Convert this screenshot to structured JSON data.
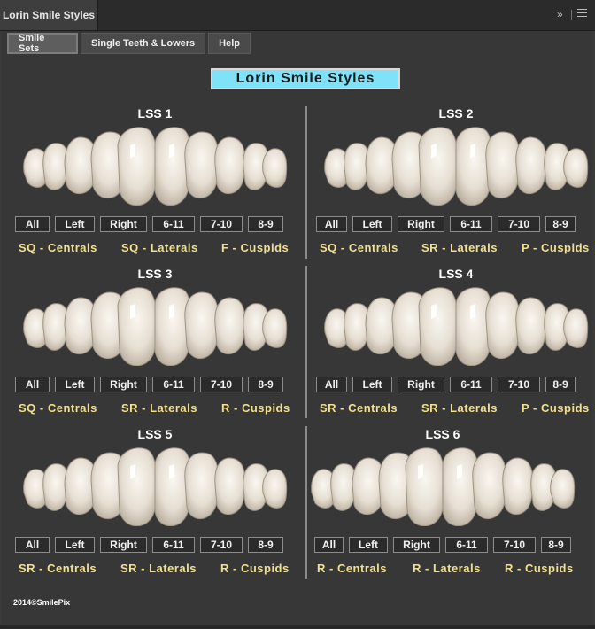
{
  "window": {
    "tab_title": "Lorin Smile Styles"
  },
  "subtabs": [
    "Smile Sets",
    "Single Teeth & Lowers",
    "Help"
  ],
  "banner": "Lorin Smile Styles",
  "buttons": [
    "All",
    "Left",
    "Right",
    "6-11",
    "7-10",
    "8-9"
  ],
  "sets": [
    {
      "title": "LSS 1",
      "labels": [
        "SQ - Centrals",
        "SQ - Laterals",
        "F - Cuspids"
      ]
    },
    {
      "title": "LSS 2",
      "labels": [
        "SQ - Centrals",
        "SR - Laterals",
        "P - Cuspids"
      ]
    },
    {
      "title": "LSS 3",
      "labels": [
        "SQ - Centrals",
        "SR - Laterals",
        "R - Cuspids"
      ]
    },
    {
      "title": "LSS 4",
      "labels": [
        "SR - Centrals",
        "SR - Laterals",
        "P - Cuspids"
      ]
    },
    {
      "title": "LSS 5",
      "labels": [
        "SR - Centrals",
        "SR - Laterals",
        "R - Cuspids"
      ]
    },
    {
      "title": "LSS 6",
      "labels": [
        "R - Centrals",
        "R - Laterals",
        "R - Cuspids"
      ]
    }
  ],
  "footer": {
    "copyright": "2014©SmilePix"
  },
  "colors": {
    "banner_bg": "#7fe2f8",
    "label_text": "#f1e08c",
    "panel_bg": "#373737"
  },
  "icons": [
    "collapse-icon",
    "panel-menu-icon"
  ]
}
